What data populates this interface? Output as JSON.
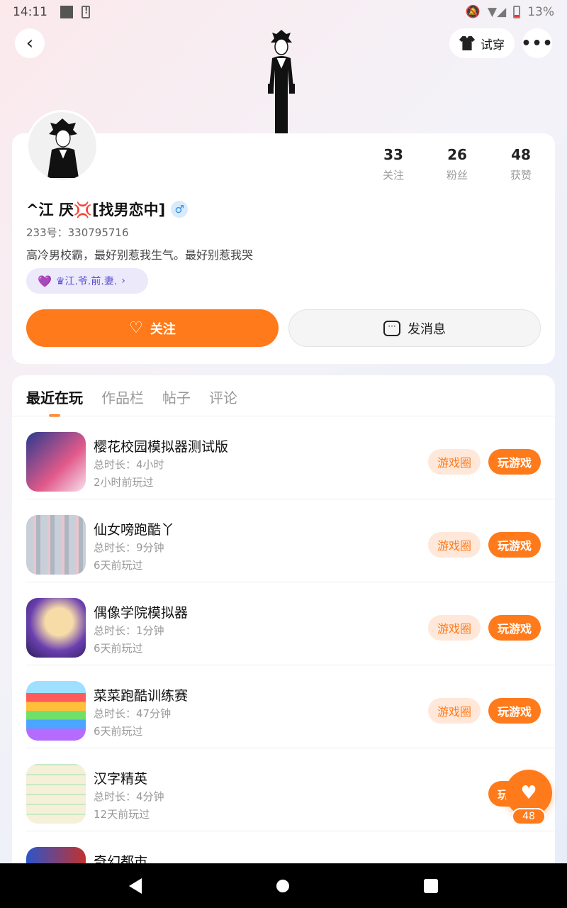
{
  "status_bar": {
    "time": "14:11",
    "battery": "13%"
  },
  "header": {
    "tryon_label": "试穿"
  },
  "profile": {
    "nickname": "^江 厌💢[找男恋中]",
    "gender_symbol": "♂",
    "uid": "233号：330795716",
    "bio": "高冷男校霸，最好别惹我生气。最好别惹我哭",
    "relation": "♛江.爷.前.妻.",
    "stats": [
      {
        "num": "33",
        "label": "关注"
      },
      {
        "num": "26",
        "label": "粉丝"
      },
      {
        "num": "48",
        "label": "获赞"
      }
    ],
    "follow_label": "关注",
    "message_label": "发消息"
  },
  "tabs": [
    {
      "label": "最近在玩",
      "active": true
    },
    {
      "label": "作品栏",
      "active": false
    },
    {
      "label": "帖子",
      "active": false
    },
    {
      "label": "评论",
      "active": false
    }
  ],
  "games": [
    {
      "name": "樱花校园模拟器测试版",
      "duration": "总时长：4小时",
      "last": "2小时前玩过",
      "icon": "gi-1"
    },
    {
      "name": "仙女嗙跑酷丫",
      "duration": "总时长：9分钟",
      "last": "6天前玩过",
      "icon": "gi-2"
    },
    {
      "name": "偶像学院模拟器",
      "duration": "总时长：1分钟",
      "last": "6天前玩过",
      "icon": "gi-3"
    },
    {
      "name": "菜菜跑酷训练赛",
      "duration": "总时长：47分钟",
      "last": "6天前玩过",
      "icon": "gi-4"
    },
    {
      "name": "汉字精英",
      "duration": "总时长：4分钟",
      "last": "12天前玩过",
      "icon": "gi-5"
    },
    {
      "name": "奇幻都市",
      "duration": "",
      "last": "",
      "icon": "gi-6"
    }
  ],
  "game_circle_label": "游戏圈",
  "play_label": "玩游戏",
  "like_count": "48",
  "colors": {
    "accent": "#ff7a1a",
    "accent_light": "#ffe8d9"
  }
}
